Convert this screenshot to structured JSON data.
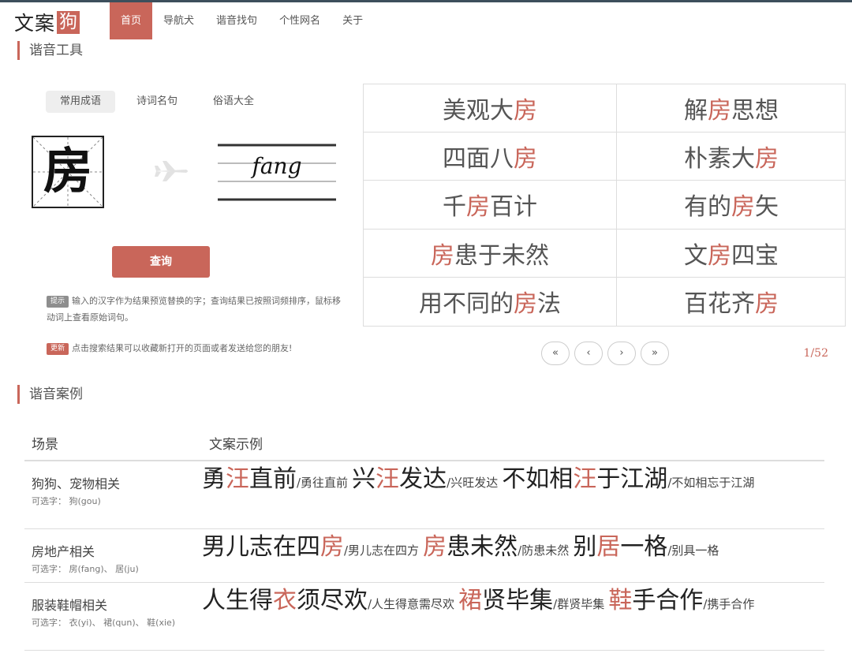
{
  "logo": {
    "text": "文案",
    "box": "狗"
  },
  "nav": {
    "items": [
      "首页",
      "导航犬",
      "谐音找句",
      "个性网名",
      "关于"
    ],
    "active_index": 0
  },
  "tool": {
    "title": "谐音工具",
    "tabs": [
      "常用成语",
      "诗词名句",
      "俗语大全"
    ],
    "active_tab": 0,
    "character": "房",
    "pinyin": "fang",
    "query_button": "查询",
    "tip_badge": "提示",
    "tip_text": "输入的汉字作为结果预览替换的字；查询结果已按照词频排序，鼠标移动词上查看原始词句。",
    "update_badge": "更新",
    "update_text": "点击搜索结果可以收藏新打开的页面或者发送给您的朋友!"
  },
  "results": [
    {
      "pre": "美观大",
      "hl": "房",
      "post": ""
    },
    {
      "pre": "解",
      "hl": "房",
      "post": "思想"
    },
    {
      "pre": "四面八",
      "hl": "房",
      "post": ""
    },
    {
      "pre": "朴素大",
      "hl": "房",
      "post": ""
    },
    {
      "pre": "千",
      "hl": "房",
      "post": "百计"
    },
    {
      "pre": "有的",
      "hl": "房",
      "post": "矢"
    },
    {
      "pre": "",
      "hl": "房",
      "post": "患于未然"
    },
    {
      "pre": "文",
      "hl": "房",
      "post": "四宝"
    },
    {
      "pre": "用不同的",
      "hl": "房",
      "post": "法"
    },
    {
      "pre": "百花齐",
      "hl": "房",
      "post": ""
    }
  ],
  "pager": {
    "first": "«",
    "prev": "‹",
    "next": "›",
    "last": "»",
    "indicator": "1/52"
  },
  "cases": {
    "title": "谐音案例",
    "headers": [
      "场景",
      "文案示例"
    ],
    "rows": [
      {
        "scene": "狗狗、宠物相关",
        "options": "可选字： 狗(gou)",
        "phrases": [
          {
            "pre": "勇",
            "hl": "汪",
            "post": "直前",
            "orig": "/勇往直前"
          },
          {
            "pre": "兴",
            "hl": "汪",
            "post": "发达",
            "orig": "/兴旺发达"
          },
          {
            "pre": "不如相",
            "hl": "汪",
            "post": "于江湖",
            "orig": "/不如相忘于江湖"
          }
        ]
      },
      {
        "scene": "房地产相关",
        "options": "可选字： 房(fang)、 居(ju)",
        "phrases": [
          {
            "pre": "男儿志在四",
            "hl": "房",
            "post": "",
            "orig": "/男儿志在四方"
          },
          {
            "pre": "",
            "hl": "房",
            "post": "患未然",
            "orig": "/防患未然"
          },
          {
            "pre": "别",
            "hl": "居",
            "post": "一格",
            "orig": "/别具一格"
          }
        ]
      },
      {
        "scene": "服装鞋帽相关",
        "options": "可选字： 衣(yi)、 裙(qun)、 鞋(xie)",
        "phrases": [
          {
            "pre": "人生得",
            "hl": "衣",
            "post": "须尽欢",
            "orig": "/人生得意需尽欢"
          },
          {
            "pre": "",
            "hl": "裙",
            "post": "贤毕集",
            "orig": "/群贤毕集"
          },
          {
            "pre": "",
            "hl": "鞋",
            "post": "手合作",
            "orig": "/携手合作"
          }
        ]
      }
    ]
  }
}
